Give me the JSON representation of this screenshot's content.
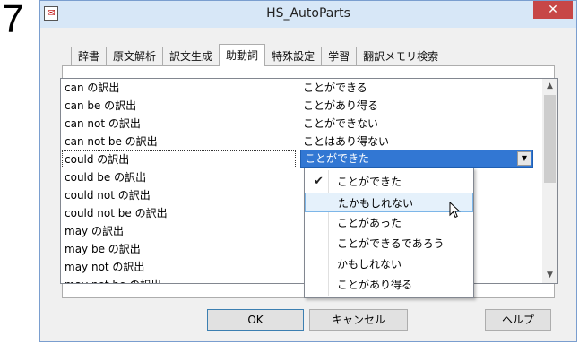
{
  "step_number": "7",
  "window": {
    "title": "HS_AutoParts",
    "app_icon": "app-icon",
    "close_icon": "close-icon"
  },
  "tabs": [
    {
      "label": "辞書",
      "active": false
    },
    {
      "label": "原文解析",
      "active": false
    },
    {
      "label": "訳文生成",
      "active": false
    },
    {
      "label": "助動詞",
      "active": true
    },
    {
      "label": "特殊設定",
      "active": false
    },
    {
      "label": "学習",
      "active": false
    },
    {
      "label": "翻訳メモリ検索",
      "active": false
    }
  ],
  "list": {
    "rows": [
      {
        "en": "can の訳出",
        "jp": "ことができる"
      },
      {
        "en": "can be の訳出",
        "jp": "ことがあり得る"
      },
      {
        "en": "can not の訳出",
        "jp": "ことができない"
      },
      {
        "en": "can not be の訳出",
        "jp": "ことはあり得ない"
      },
      {
        "en": "could の訳出",
        "jp": ""
      },
      {
        "en": "could be の訳出",
        "jp": ""
      },
      {
        "en": "could not の訳出",
        "jp": ""
      },
      {
        "en": "could not be の訳出",
        "jp": ""
      },
      {
        "en": "may の訳出",
        "jp": ""
      },
      {
        "en": "may be の訳出",
        "jp": ""
      },
      {
        "en": "may not の訳出",
        "jp": ""
      },
      {
        "en": "may not be の訳出",
        "jp": ""
      }
    ],
    "selected_index": 4
  },
  "combo": {
    "value": "ことができた",
    "button_glyph": "▼"
  },
  "dropdown": {
    "options": [
      {
        "label": "ことができた",
        "checked": true
      },
      {
        "label": "たかもしれない",
        "hover": true
      },
      {
        "label": "ことがあった"
      },
      {
        "label": "ことができるであろう"
      },
      {
        "label": "かもしれない"
      },
      {
        "label": "ことがあり得る"
      }
    ],
    "check_glyph": "✔"
  },
  "buttons": {
    "ok": "OK",
    "cancel": "キャンセル",
    "help": "ヘルプ"
  },
  "colors": {
    "selection": "#3277d3",
    "hover": "#e5f1fb",
    "close": "#c74747"
  }
}
